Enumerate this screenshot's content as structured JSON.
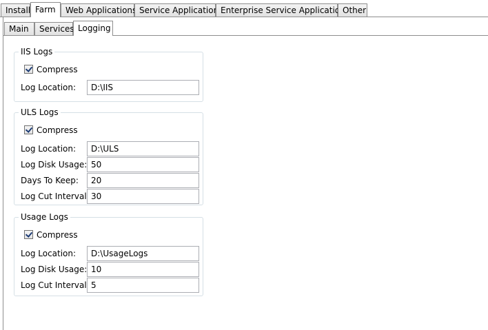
{
  "main_tabs": [
    {
      "label": "Install",
      "active": false
    },
    {
      "label": "Farm",
      "active": true
    },
    {
      "label": "Web Applications",
      "active": false
    },
    {
      "label": "Service Applications",
      "active": false
    },
    {
      "label": "Enterprise Service Applications",
      "active": false
    },
    {
      "label": "Other",
      "active": false
    }
  ],
  "sub_tabs": [
    {
      "label": "Main",
      "active": false
    },
    {
      "label": "Services",
      "active": false
    },
    {
      "label": "Logging",
      "active": true
    }
  ],
  "iis": {
    "legend": "IIS Logs",
    "compress": {
      "label": "Compress",
      "checked": true
    },
    "log_location": {
      "label": "Log Location:",
      "value": "D:\\IIS"
    }
  },
  "uls": {
    "legend": "ULS Logs",
    "compress": {
      "label": "Compress",
      "checked": true
    },
    "log_location": {
      "label": "Log Location:",
      "value": "D:\\ULS"
    },
    "log_disk_usage": {
      "label": "Log Disk Usage:",
      "value": "50"
    },
    "days_to_keep": {
      "label": "Days To Keep:",
      "value": "20"
    },
    "log_cut_interval": {
      "label": "Log Cut Interval:",
      "value": "30"
    }
  },
  "usage": {
    "legend": "Usage Logs",
    "compress": {
      "label": "Compress",
      "checked": true
    },
    "log_location": {
      "label": "Log Location:",
      "value": "D:\\UsageLogs"
    },
    "log_disk_usage": {
      "label": "Log Disk Usage:",
      "value": "10"
    },
    "log_cut_interval": {
      "label": "Log Cut Interval:",
      "value": "5"
    }
  }
}
